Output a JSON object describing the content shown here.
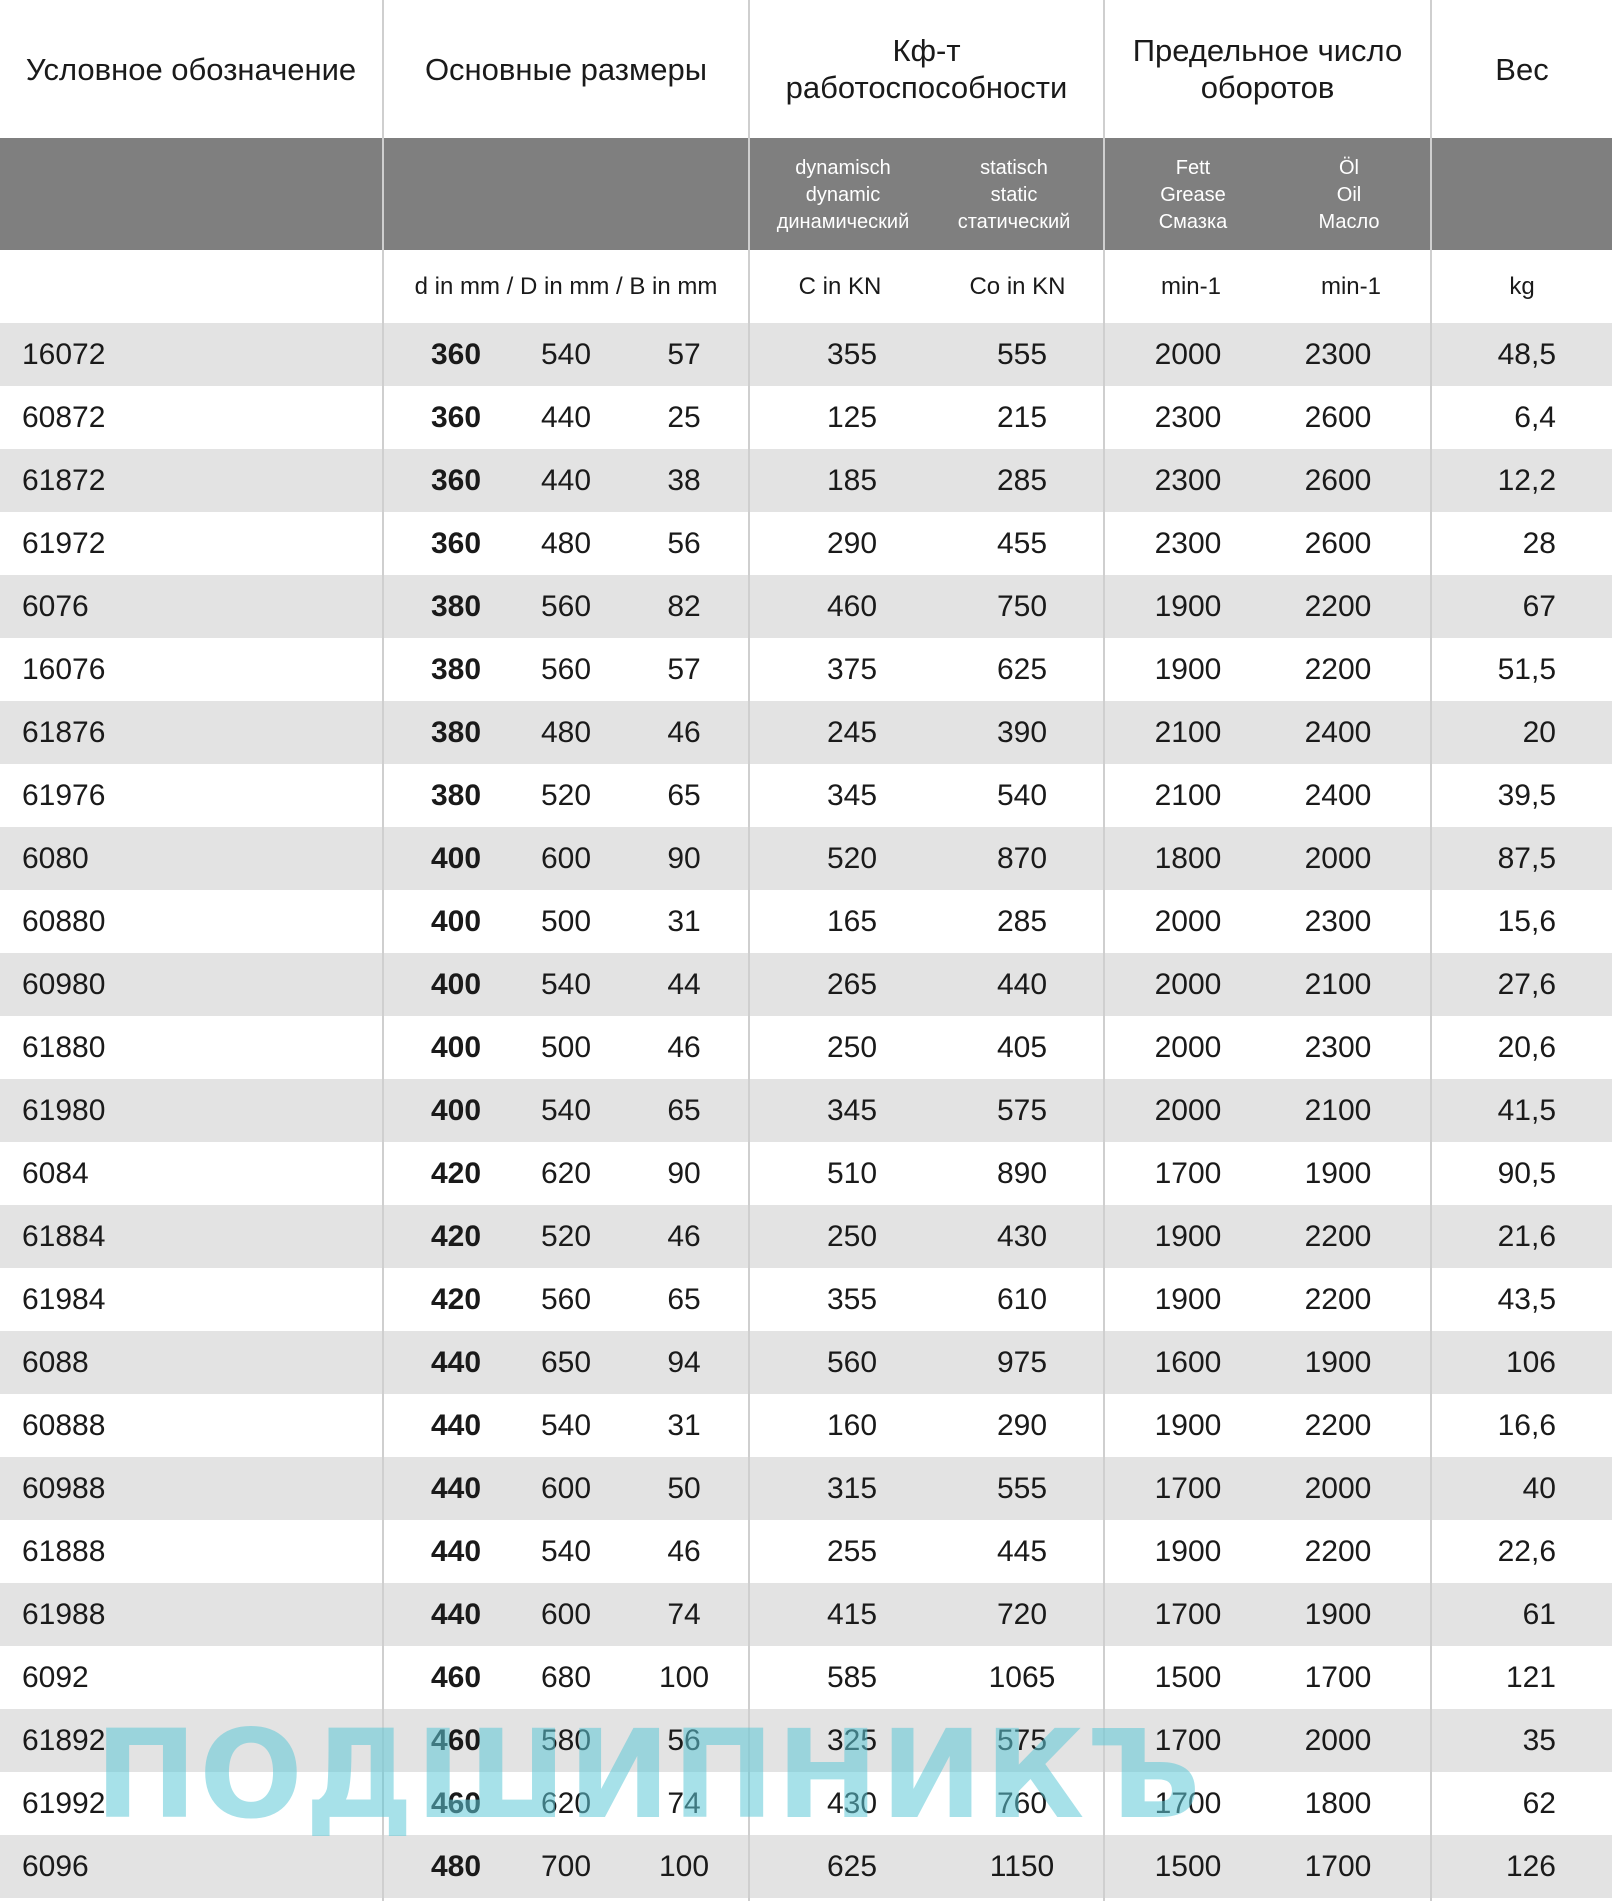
{
  "header": {
    "designation": "Условное обозначение",
    "dimensions": "Основные размеры",
    "load_rating": "Кф-т\nработоспособности",
    "speed_limit": "Предельное число\nоборотов",
    "weight": "Вес"
  },
  "subheader": {
    "dynamic": "dynamisch\ndynamic\nдинамический",
    "static": "statisch\nstatic\nстатический",
    "grease": "Fett\nGrease\nСмазка",
    "oil": "Öl\nOil\nМасло"
  },
  "units": {
    "dimensions": "d in mm / D in mm / B in mm",
    "c": "C in KN",
    "co": "Co in KN",
    "grease": "min-1",
    "oil": "min-1",
    "weight": "kg"
  },
  "rows": [
    [
      "16072",
      "360",
      "540",
      "57",
      "355",
      "555",
      "2000",
      "2300",
      "48,5"
    ],
    [
      "60872",
      "360",
      "440",
      "25",
      "125",
      "215",
      "2300",
      "2600",
      "6,4"
    ],
    [
      "61872",
      "360",
      "440",
      "38",
      "185",
      "285",
      "2300",
      "2600",
      "12,2"
    ],
    [
      "61972",
      "360",
      "480",
      "56",
      "290",
      "455",
      "2300",
      "2600",
      "28"
    ],
    [
      "6076",
      "380",
      "560",
      "82",
      "460",
      "750",
      "1900",
      "2200",
      "67"
    ],
    [
      "16076",
      "380",
      "560",
      "57",
      "375",
      "625",
      "1900",
      "2200",
      "51,5"
    ],
    [
      "61876",
      "380",
      "480",
      "46",
      "245",
      "390",
      "2100",
      "2400",
      "20"
    ],
    [
      "61976",
      "380",
      "520",
      "65",
      "345",
      "540",
      "2100",
      "2400",
      "39,5"
    ],
    [
      "6080",
      "400",
      "600",
      "90",
      "520",
      "870",
      "1800",
      "2000",
      "87,5"
    ],
    [
      "60880",
      "400",
      "500",
      "31",
      "165",
      "285",
      "2000",
      "2300",
      "15,6"
    ],
    [
      "60980",
      "400",
      "540",
      "44",
      "265",
      "440",
      "2000",
      "2100",
      "27,6"
    ],
    [
      "61880",
      "400",
      "500",
      "46",
      "250",
      "405",
      "2000",
      "2300",
      "20,6"
    ],
    [
      "61980",
      "400",
      "540",
      "65",
      "345",
      "575",
      "2000",
      "2100",
      "41,5"
    ],
    [
      "6084",
      "420",
      "620",
      "90",
      "510",
      "890",
      "1700",
      "1900",
      "90,5"
    ],
    [
      "61884",
      "420",
      "520",
      "46",
      "250",
      "430",
      "1900",
      "2200",
      "21,6"
    ],
    [
      "61984",
      "420",
      "560",
      "65",
      "355",
      "610",
      "1900",
      "2200",
      "43,5"
    ],
    [
      "6088",
      "440",
      "650",
      "94",
      "560",
      "975",
      "1600",
      "1900",
      "106"
    ],
    [
      "60888",
      "440",
      "540",
      "31",
      "160",
      "290",
      "1900",
      "2200",
      "16,6"
    ],
    [
      "60988",
      "440",
      "600",
      "50",
      "315",
      "555",
      "1700",
      "2000",
      "40"
    ],
    [
      "61888",
      "440",
      "540",
      "46",
      "255",
      "445",
      "1900",
      "2200",
      "22,6"
    ],
    [
      "61988",
      "440",
      "600",
      "74",
      "415",
      "720",
      "1700",
      "1900",
      "61"
    ],
    [
      "6092",
      "460",
      "680",
      "100",
      "585",
      "1065",
      "1500",
      "1700",
      "121"
    ],
    [
      "61892",
      "460",
      "580",
      "56",
      "325",
      "575",
      "1700",
      "2000",
      "35"
    ],
    [
      "61992",
      "460",
      "620",
      "74",
      "430",
      "760",
      "1700",
      "1800",
      "62"
    ],
    [
      "6096",
      "480",
      "700",
      "100",
      "625",
      "1150",
      "1500",
      "1700",
      "126"
    ]
  ],
  "watermark": {
    "text": "ПОДШИПНИКЪ",
    "color": "#5fc8d7"
  }
}
